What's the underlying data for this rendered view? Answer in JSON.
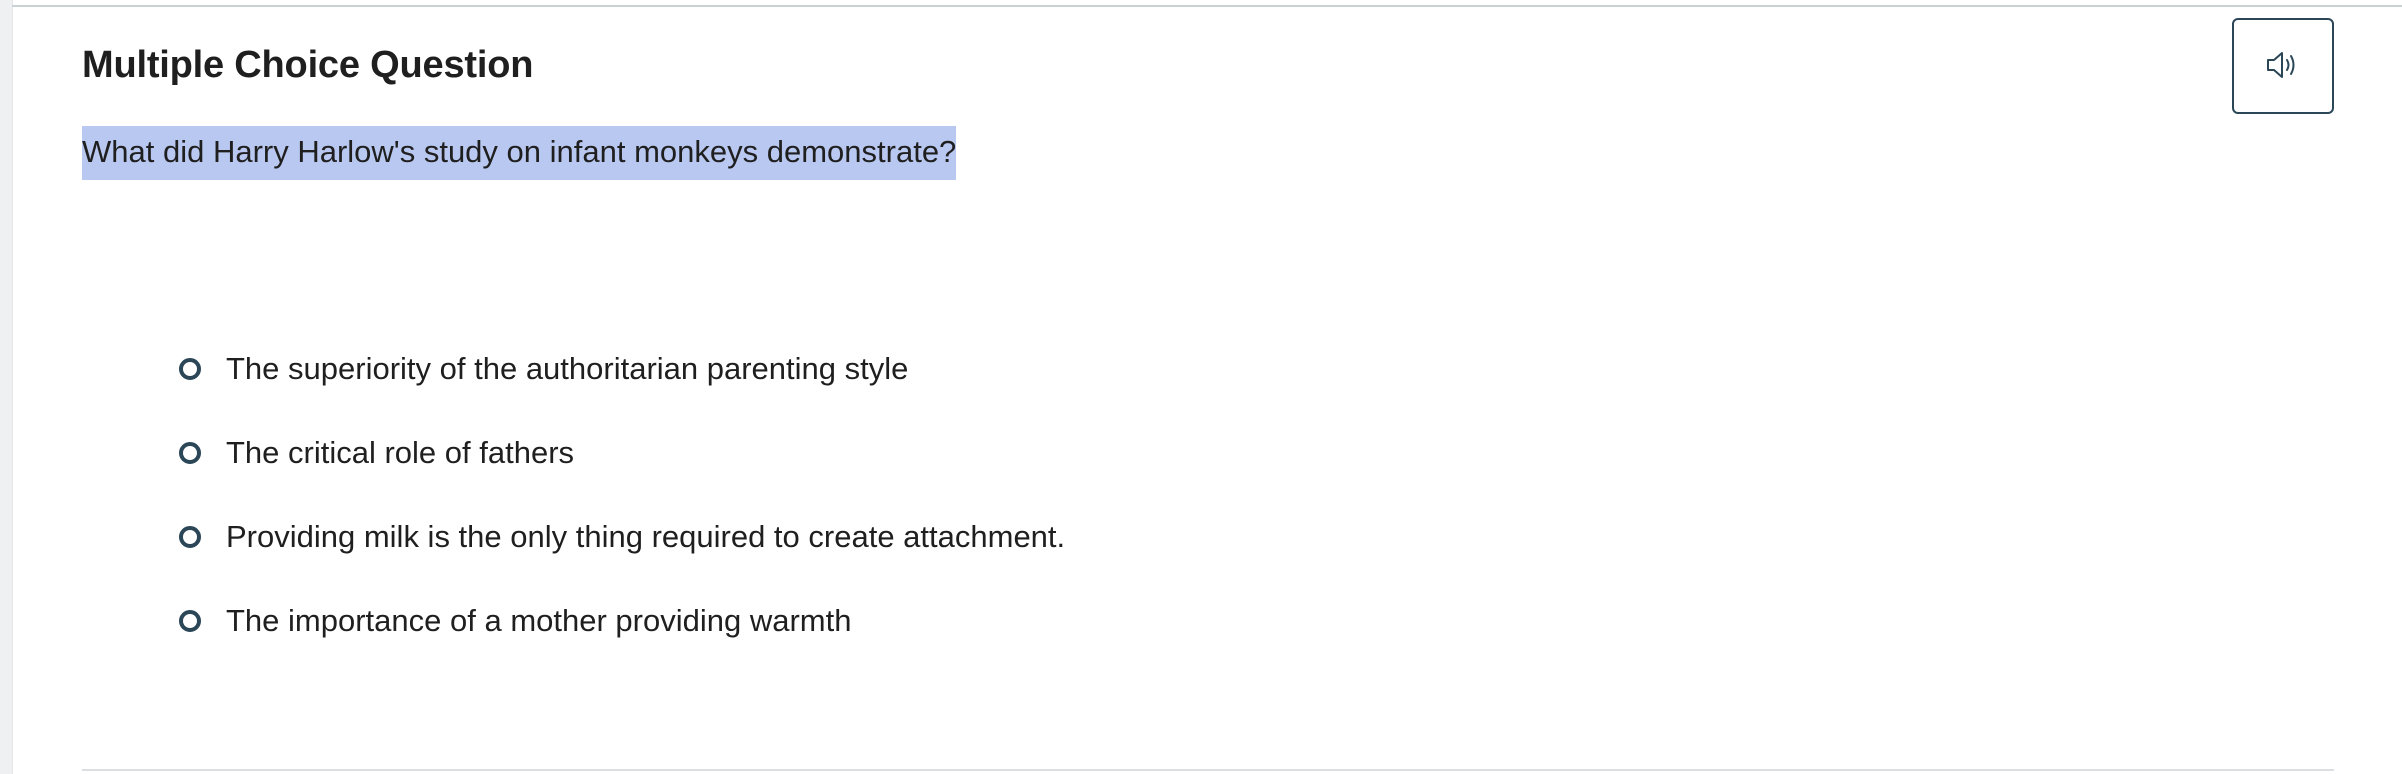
{
  "question": {
    "type_label": "Multiple Choice Question",
    "prompt": "What did Harry Harlow's study on infant monkeys demonstrate?",
    "audio_icon": "speaker-icon",
    "choices": [
      {
        "label": "The superiority of the authoritarian parenting style",
        "selected": false
      },
      {
        "label": "The critical role of fathers",
        "selected": false
      },
      {
        "label": "Providing milk is the only thing required to create attachment.",
        "selected": false
      },
      {
        "label": "The importance of a mother providing warmth",
        "selected": false
      }
    ]
  },
  "colors": {
    "accent": "#2a4657",
    "highlight": "#b9c8f0",
    "text": "#1f1f1f"
  }
}
